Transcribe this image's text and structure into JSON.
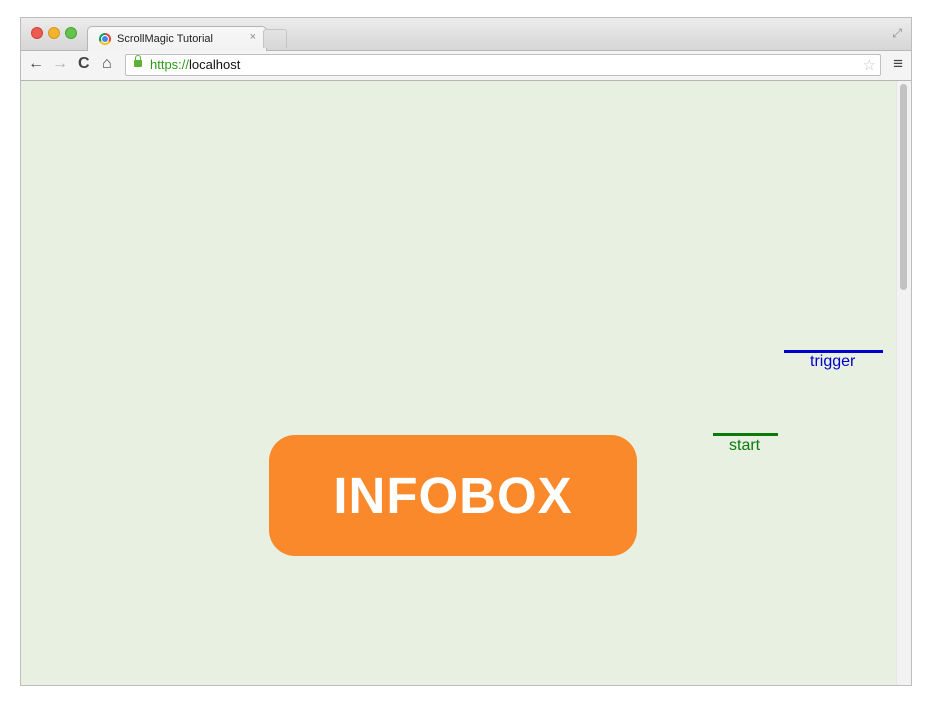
{
  "browser": {
    "tab": {
      "title": "ScrollMagic Tutorial",
      "close_glyph": "×",
      "favicon": "chrome-icon"
    },
    "address": {
      "scheme": "https://",
      "host": "localhost"
    },
    "icons": {
      "back": "←",
      "forward": "→",
      "reload": "C",
      "home": "⌂",
      "star": "☆",
      "menu": "≡",
      "fullscreen": "⤢"
    }
  },
  "page": {
    "background": "#e8f0e2",
    "infobox": {
      "label": "INFOBOX",
      "color": "#f9892a"
    },
    "indicators": {
      "trigger": {
        "label": "trigger",
        "color": "#0000cc"
      },
      "start": {
        "label": "start",
        "color": "#0a7a0a"
      }
    }
  }
}
